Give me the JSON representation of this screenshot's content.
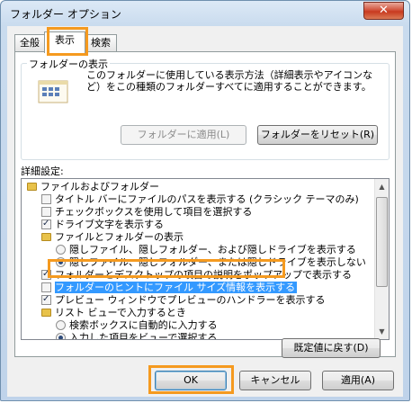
{
  "window": {
    "title": "フォルダー オプション",
    "close_glyph": "✕"
  },
  "tabs": [
    {
      "label": "全般"
    },
    {
      "label": "表示"
    },
    {
      "label": "検索"
    }
  ],
  "folder_views": {
    "group_label": "フォルダーの表示",
    "description": "このフォルダーに使用している表示方法（詳細表示やアイコンなど）をこの種類のフォルダーすべてに適用することができます。",
    "apply_button": "フォルダーに適用(L)",
    "reset_button": "フォルダーをリセット(R)"
  },
  "advanced": {
    "label": "詳細設定:",
    "items": [
      {
        "type": "folder",
        "level": 0,
        "label": "ファイルおよびフォルダー"
      },
      {
        "type": "checkbox",
        "level": 1,
        "checked": false,
        "label": "タイトル バーにファイルのパスを表示する (クラシック テーマのみ)"
      },
      {
        "type": "checkbox",
        "level": 1,
        "checked": false,
        "label": "チェックボックスを使用して項目を選択する"
      },
      {
        "type": "checkbox",
        "level": 1,
        "checked": true,
        "label": "ドライブ文字を表示する"
      },
      {
        "type": "folder",
        "level": 1,
        "label": "ファイルとフォルダーの表示"
      },
      {
        "type": "radio",
        "level": 2,
        "checked": false,
        "label": "隠しファイル、隠しフォルダー、および隠しドライブを表示する"
      },
      {
        "type": "radio",
        "level": 2,
        "checked": true,
        "label": "隠しファイル、隠しフォルダー、または隠しドライブを表示しない"
      },
      {
        "type": "checkbox",
        "level": 1,
        "checked": true,
        "label": "フォルダーとデスクトップの項目の説明をポップアップで表示する"
      },
      {
        "type": "checkbox",
        "level": 1,
        "checked": false,
        "label": "フォルダーのヒントにファイル サイズ情報を表示する",
        "highlighted": true
      },
      {
        "type": "checkbox",
        "level": 1,
        "checked": true,
        "label": "プレビュー ウィンドウでプレビューのハンドラーを表示する"
      },
      {
        "type": "folder",
        "level": 1,
        "label": "リスト ビューで入力するとき"
      },
      {
        "type": "radio",
        "level": 2,
        "checked": false,
        "label": "検索ボックスに自動的に入力する"
      },
      {
        "type": "radio",
        "level": 2,
        "checked": true,
        "label": "入力した項目をビューで選択する"
      }
    ],
    "restore_button": "既定値に戻す(D)"
  },
  "footer": {
    "ok": "OK",
    "cancel": "キャンセル",
    "apply": "適用(A)"
  },
  "colors": {
    "highlight_outline": "#f59a1f",
    "selection": "#3399ff"
  }
}
